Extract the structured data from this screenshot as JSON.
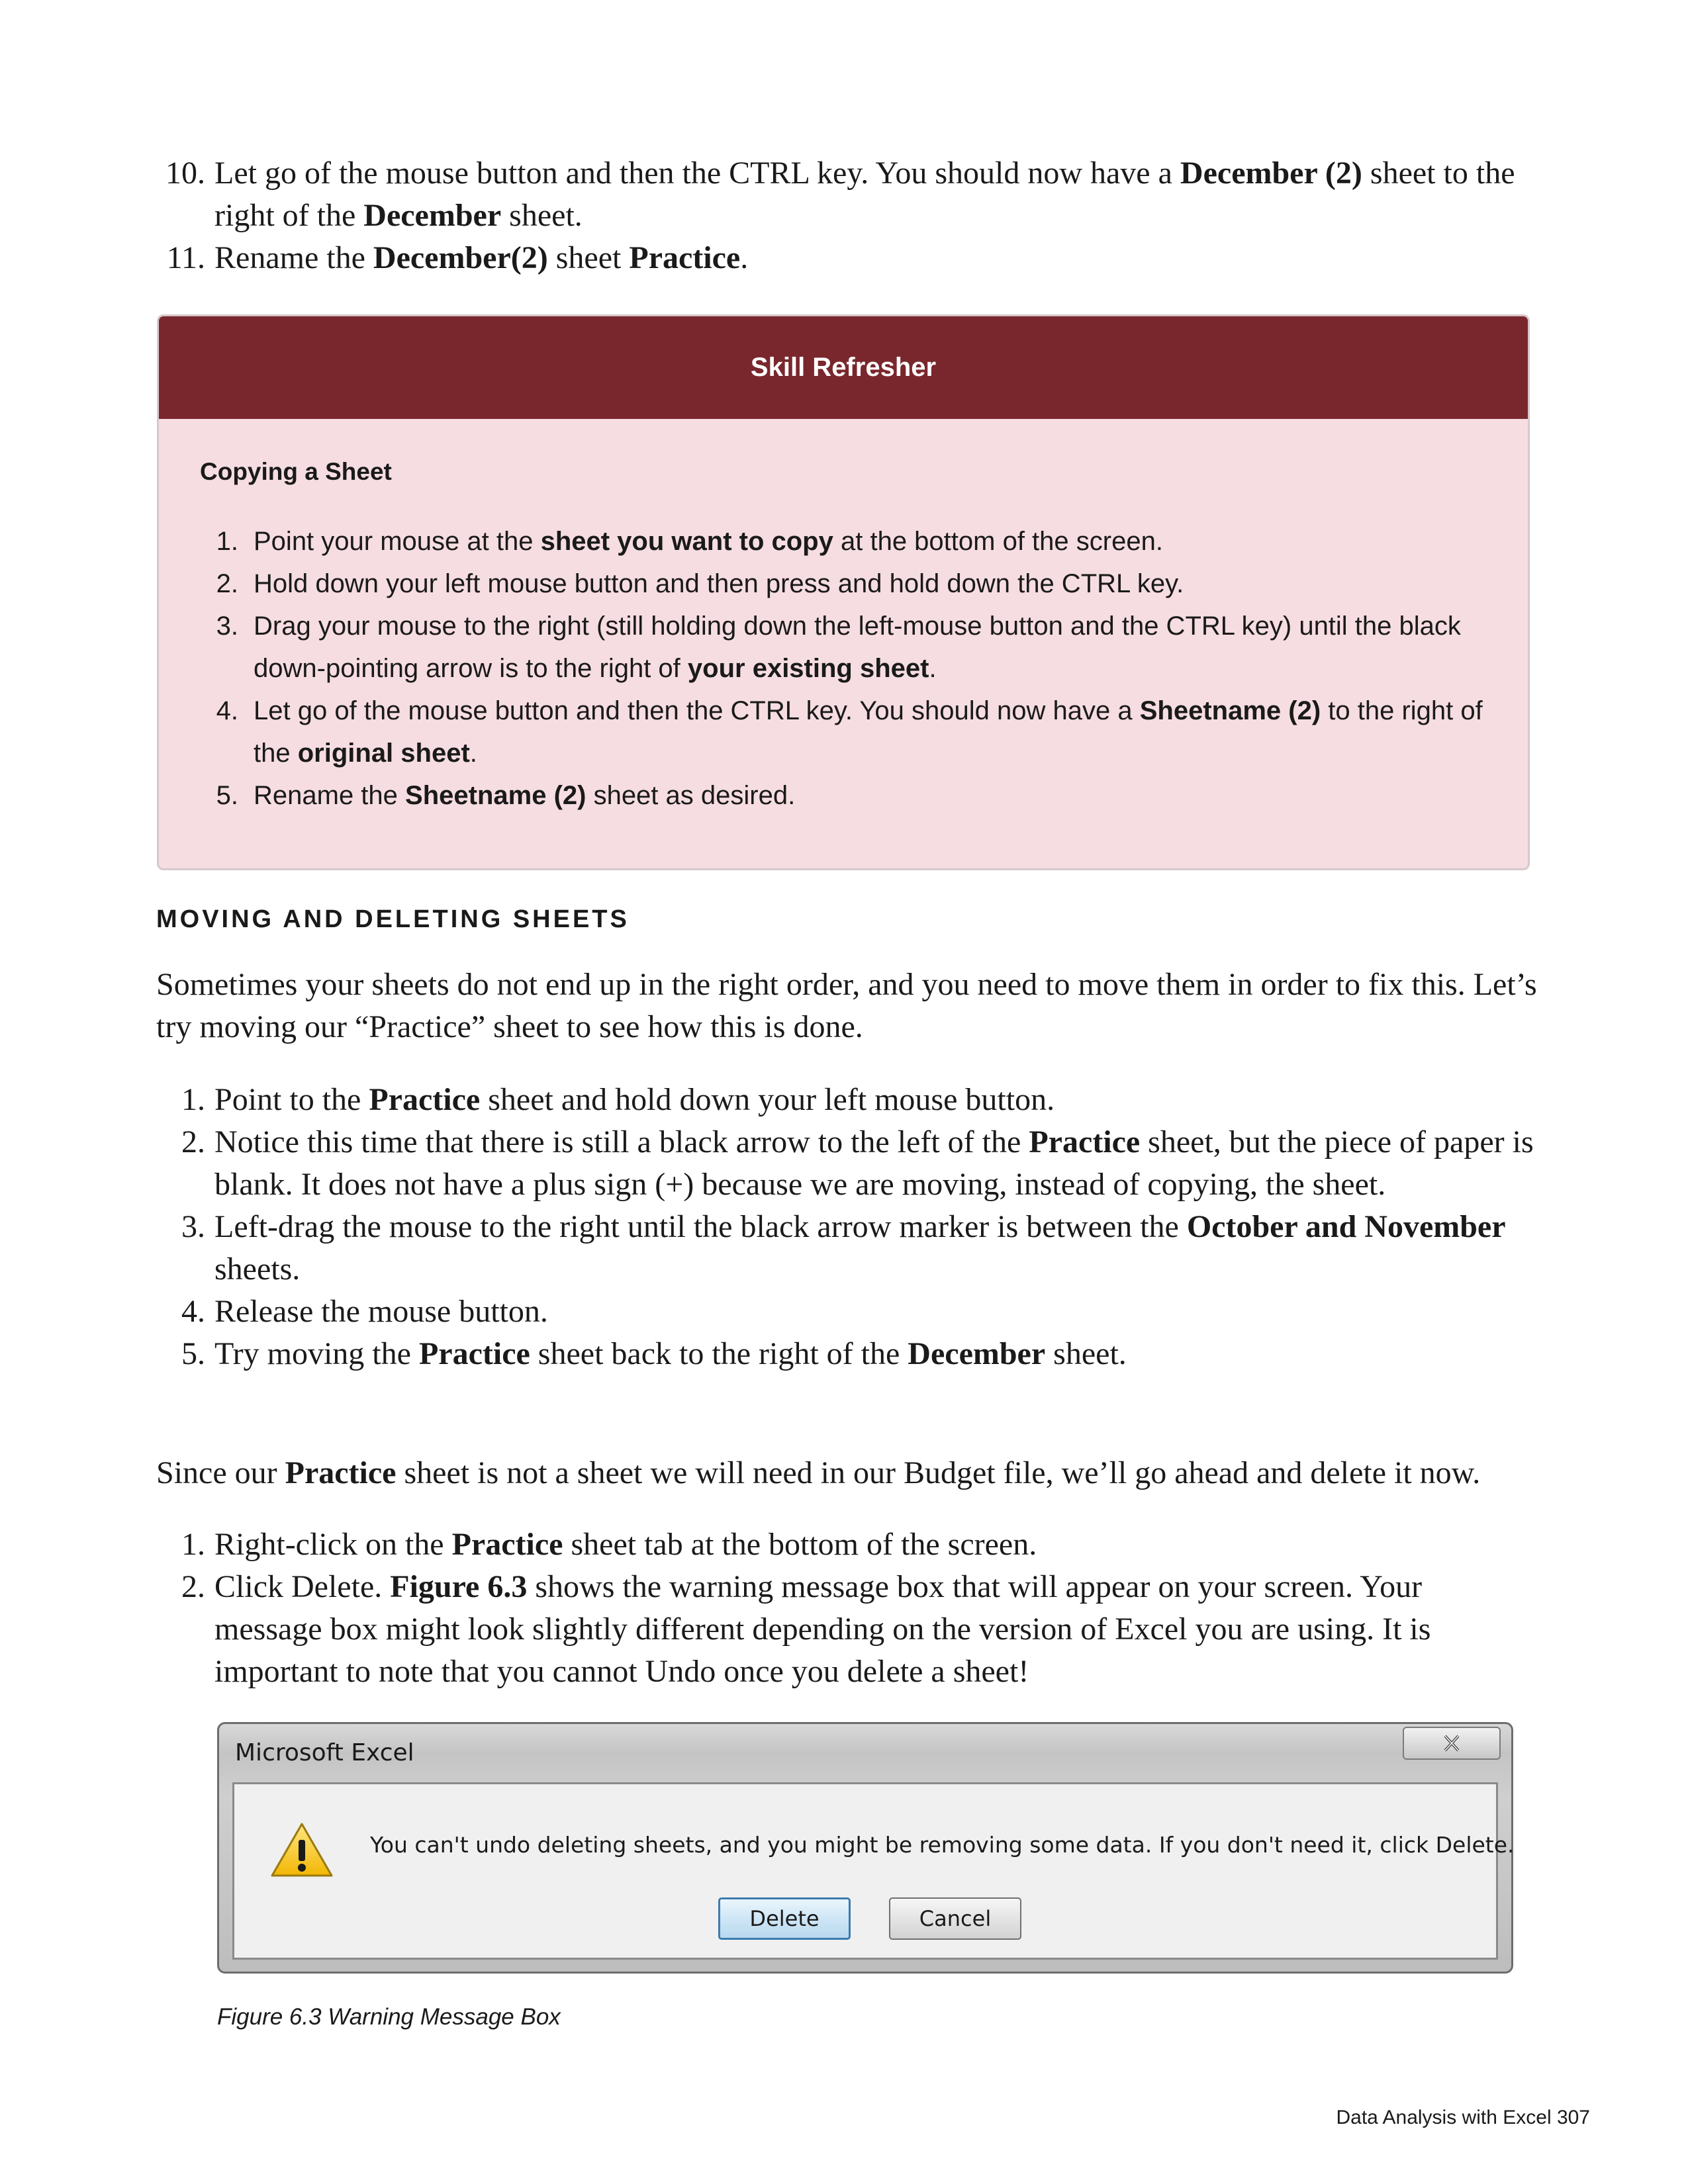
{
  "top_list": [
    {
      "num": "10.",
      "t1": "Let go of the mouse button and then the CTRL key. You should now have a ",
      "b1": "December (2)",
      "t2": " sheet to the right of the ",
      "b2": "December",
      "t3": " sheet."
    },
    {
      "num": "11.",
      "t1": "Rename the ",
      "b1": "December(2)",
      "t2": " sheet ",
      "b2": "Practice",
      "t3": "."
    }
  ],
  "refresher": {
    "header": "Skill Refresher",
    "subtitle": "Copying a Sheet",
    "steps": [
      {
        "num": "1.",
        "t1": "Point your mouse at the ",
        "b1": "sheet you want to copy",
        "t2": " at the bottom of the screen.",
        "b2": "",
        "t3": ""
      },
      {
        "num": "2.",
        "t1": "Hold down your left mouse button and then press and hold down the CTRL key.",
        "b1": "",
        "t2": "",
        "b2": "",
        "t3": ""
      },
      {
        "num": "3.",
        "t1": "Drag your mouse to the right (still holding down the left-mouse button and the CTRL key) until the black down-pointing arrow is to the right of  ",
        "b1": "your existing sheet",
        "t2": ".",
        "b2": "",
        "t3": ""
      },
      {
        "num": "4.",
        "t1": "Let go of the mouse button and then the CTRL key. You should now have a ",
        "b1": "Sheetname (2)",
        "t2": " to the right of the ",
        "b2": "original sheet",
        "t3": "."
      },
      {
        "num": "5.",
        "t1": "Rename the ",
        "b1": "Sheetname (2)",
        "t2": " sheet as desired.",
        "b2": "",
        "t3": ""
      }
    ]
  },
  "section_heading": "MOVING AND DELETING SHEETS",
  "intro_paragraph": "Sometimes your sheets do not end up in the right order, and you need to move them in order to fix this. Let’s try moving our “Practice” sheet to see how this is done.",
  "move_steps": [
    {
      "num": "1.",
      "t1": "Point to the ",
      "b1": "Practice",
      "t2": " sheet and hold down your left mouse button.",
      "b2": "",
      "t3": ""
    },
    {
      "num": "2.",
      "t1": "Notice this time that there is still a black arrow to the left of the ",
      "b1": "Practice",
      "t2": " sheet, but the piece of paper is blank. It does not have a plus sign (+) because we are moving, instead of copying, the sheet.",
      "b2": "",
      "t3": ""
    },
    {
      "num": "3.",
      "t1": "Left-drag the mouse to the right until the black arrow marker is between the ",
      "b1": "October and November",
      "t2": " sheets.",
      "b2": "",
      "t3": ""
    },
    {
      "num": "4.",
      "t1": "Release the mouse button.",
      "b1": "",
      "t2": "",
      "b2": "",
      "t3": ""
    },
    {
      "num": "5.",
      "t1": "Try moving the ",
      "b1": "Practice",
      "t2": " sheet back to the right of the ",
      "b2": "December",
      "t3": " sheet."
    }
  ],
  "delete_paragraph": {
    "t1": "Since our ",
    "b1": "Practice",
    "t2": " sheet is not a sheet we will need in our Budget file, we’ll go ahead and delete it now."
  },
  "delete_steps": [
    {
      "num": "1.",
      "t1": "Right-click on the ",
      "b1": "Practice",
      "t2": " sheet tab at the bottom of the screen.",
      "b2": "",
      "t3": ""
    },
    {
      "num": "2.",
      "t1": "Click Delete. ",
      "b1": "Figure 6.3",
      "t2": " shows the warning message box that will appear on your screen.  Your message box might look slightly different depending on the version of Excel you are using. It is important to note that you cannot Undo once you delete a sheet!",
      "b2": "",
      "t3": ""
    }
  ],
  "dialog": {
    "title": "Microsoft Excel",
    "message": "You can't undo deleting sheets, and you might be removing some data. If you don't need it, click Delete.",
    "delete_label": "Delete",
    "cancel_label": "Cancel",
    "icons": {
      "warning": "warning-triangle-icon",
      "close": "close-x-icon"
    }
  },
  "figure_caption": "Figure 6.3 Warning Message Box",
  "footer": "Data Analysis with Excel 307",
  "colors": {
    "refresher_header": "#79272d",
    "refresher_body": "#f6dde2"
  }
}
